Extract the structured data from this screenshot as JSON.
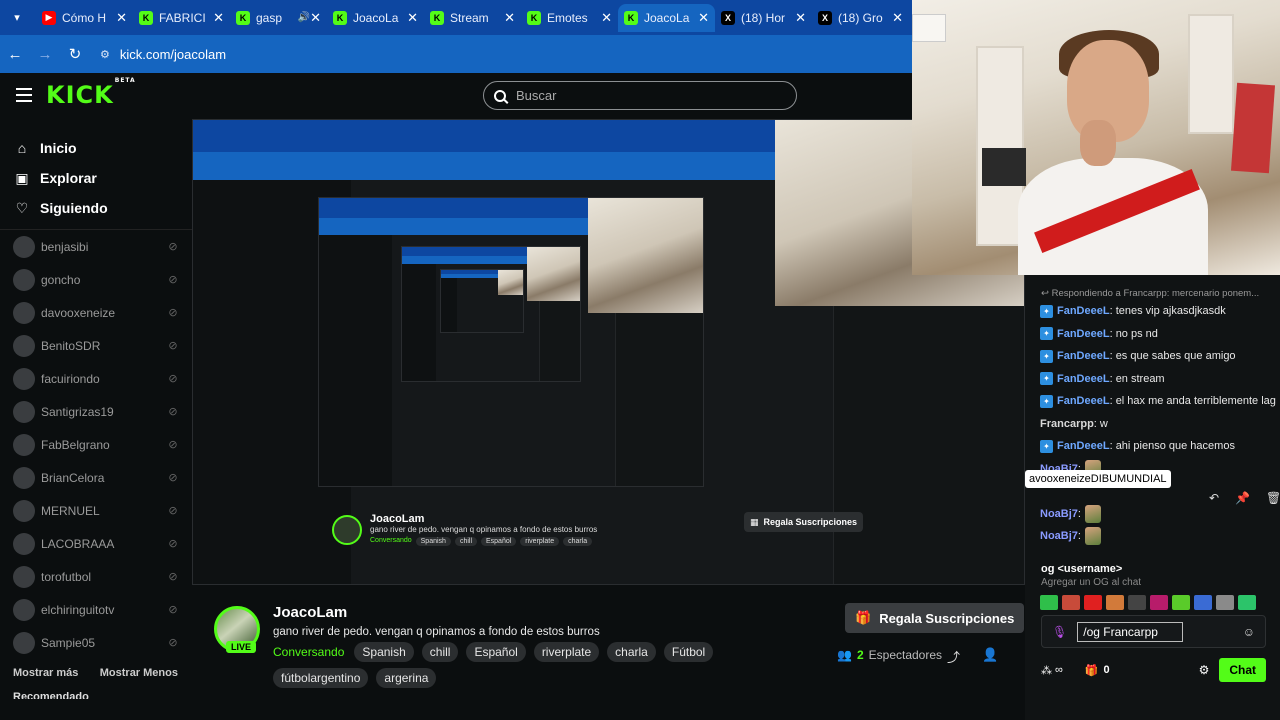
{
  "browser": {
    "tabs": [
      {
        "label": "Cómo H",
        "favicon": "youtube-icon",
        "kind": "yt"
      },
      {
        "label": "FABRICI",
        "favicon": "kick-icon",
        "kind": "k"
      },
      {
        "label": "gasp",
        "favicon": "kick-icon",
        "kind": "k",
        "audio": true
      },
      {
        "label": "JoacoLa",
        "favicon": "kick-icon",
        "kind": "k"
      },
      {
        "label": "Stream",
        "favicon": "kick-icon",
        "kind": "k"
      },
      {
        "label": "Emotes",
        "favicon": "kick-icon",
        "kind": "k"
      },
      {
        "label": "JoacoLa",
        "favicon": "kick-icon",
        "kind": "k",
        "active": true
      },
      {
        "label": "(18) Hor",
        "favicon": "x-icon",
        "kind": "x"
      },
      {
        "label": "(18) Gro",
        "favicon": "x-icon",
        "kind": "x"
      }
    ],
    "url": "kick.com/joacolam"
  },
  "header": {
    "logo": "KICK",
    "logo_tag": "BETA",
    "search_placeholder": "Buscar"
  },
  "sidebar": {
    "nav": [
      {
        "label": "Inicio",
        "icon": "home-icon"
      },
      {
        "label": "Explorar",
        "icon": "explore-icon"
      },
      {
        "label": "Siguiendo",
        "icon": "heart-icon"
      }
    ],
    "following": [
      "benjasibi",
      "goncho",
      "davooxeneize",
      "BenitoSDR",
      "facuiriondo",
      "Santigrizas19",
      "FabBelgrano",
      "BrianCelora",
      "MERNUEL",
      "LACOBRAAA",
      "torofutbol",
      "elchiringuitotv",
      "Sampie05"
    ],
    "show_more": "Mostrar más",
    "show_less": "Mostrar Menos",
    "recommended": "Recomendado"
  },
  "stream": {
    "name": "JoacoLam",
    "title": "gano river de pedo. vengan q opinamos a fondo de estos burros",
    "live": "LIVE",
    "category": "Conversando",
    "tags": [
      "Spanish",
      "chill",
      "Español",
      "riverplate",
      "charla",
      "Fútbol",
      "fútbolargentino",
      "argerina"
    ],
    "gift_button": "Regala Suscripciones",
    "viewers_count": "2",
    "viewers_label": "Espectadores"
  },
  "chat": {
    "reply_to": "Respondiendo a Francarpp: mercenario ponem...",
    "messages": [
      {
        "user": "FanDeeeL",
        "text": ": tenes vip ajkasdjkasdk",
        "badge": true
      },
      {
        "user": "FanDeeeL",
        "text": ": no ps nd",
        "badge": true
      },
      {
        "user": "FanDeeeL",
        "text": ": es que sabes que amigo",
        "badge": true
      },
      {
        "user": "FanDeeeL",
        "text": ": en stream",
        "badge": true
      },
      {
        "user": "FanDeeeL",
        "text": ": el hax me anda terriblemente lag",
        "badge": true
      },
      {
        "user": "Francarpp",
        "text": ": w",
        "badge": false
      },
      {
        "user": "FanDeeeL",
        "text": ": ahi pienso que hacemos",
        "badge": true
      },
      {
        "user": "NoaBj7",
        "text": ":",
        "badge": false,
        "emote": true
      },
      {
        "user": "",
        "text": "",
        "badge": false
      },
      {
        "user": "NoaBj7",
        "text": ":",
        "badge": false,
        "emote": true
      },
      {
        "user": "NoaBj7",
        "text": ":",
        "badge": false,
        "emote": true
      }
    ],
    "tooltip": "avooxeneizeDIBUMUNDIAL",
    "og_command": "og <username>",
    "og_description": "Agregar un OG al chat",
    "input_value": "/og Francarpp",
    "points": "∞",
    "gift_count": "0",
    "send_label": "Chat"
  },
  "colors": {
    "kick_green": "#53fc18",
    "tabbar": "#0d47a1",
    "addrbar": "#1565c0",
    "background": "#0b0e0f"
  }
}
